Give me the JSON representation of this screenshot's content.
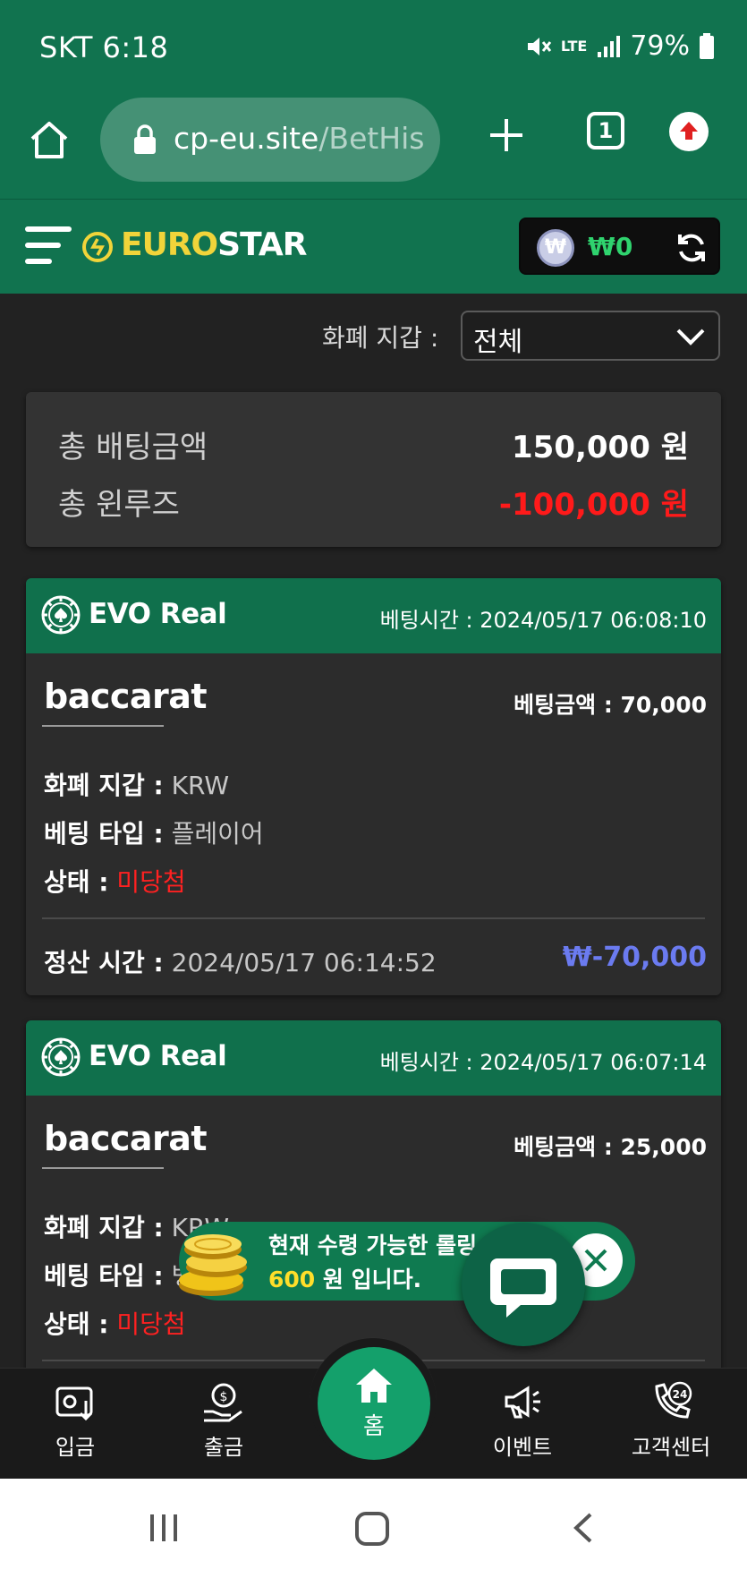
{
  "status_bar": {
    "carrier_time": "SKT 6:18",
    "battery": "79%",
    "network": "LTE"
  },
  "browser": {
    "url_main": "cp-eu.site",
    "url_path": "/BetHis",
    "tab_count": "1"
  },
  "header": {
    "logo_euro": "EURO",
    "logo_star": "STAR",
    "wallet_amount": "₩0",
    "currency_symbol": "₩"
  },
  "filter": {
    "label": "화폐 지갑 :",
    "selected": "전체"
  },
  "summary": {
    "total_bet_label": "총 배팅금액",
    "total_bet_value": "150,000 원",
    "total_winloss_label": "총 윈루즈",
    "total_winloss_value": "-100,000 원"
  },
  "bets": [
    {
      "provider": "EVO Real",
      "bet_time": "베팅시간 : 2024/05/17 06:08:10",
      "game": "baccarat",
      "bet_amount": "베팅금액 : 70,000",
      "wallet_label": "화폐 지갑 :",
      "wallet_value": "KRW",
      "type_label": "베팅 타입 :",
      "type_value": "플레이어",
      "status_label": "상태 :",
      "status_value": "미당첨",
      "settle_label": "정산 시간 :",
      "settle_value": "2024/05/17 06:14:52",
      "result": "₩-70,000"
    },
    {
      "provider": "EVO Real",
      "bet_time": "베팅시간 : 2024/05/17 06:07:14",
      "game": "baccarat",
      "bet_amount": "베팅금액 : 25,000",
      "wallet_label": "화폐 지갑 :",
      "wallet_value": "KRW",
      "type_label": "베팅 타입 :",
      "type_value": "뱅",
      "status_label": "상태 :",
      "status_value": "미당첨"
    }
  ],
  "toast": {
    "line1": "현재 수령 가능한 롤링",
    "amount": "600",
    "line2_rest": " 원 입니다."
  },
  "bottom_nav": {
    "deposit": "입금",
    "withdraw": "출금",
    "home": "홈",
    "event": "이벤트",
    "support": "고객센터"
  },
  "colors": {
    "primary_green": "#11734f",
    "negative_red": "#ff1a1a",
    "result_blue": "#6b7bf0",
    "wallet_green": "#2fd36e"
  }
}
